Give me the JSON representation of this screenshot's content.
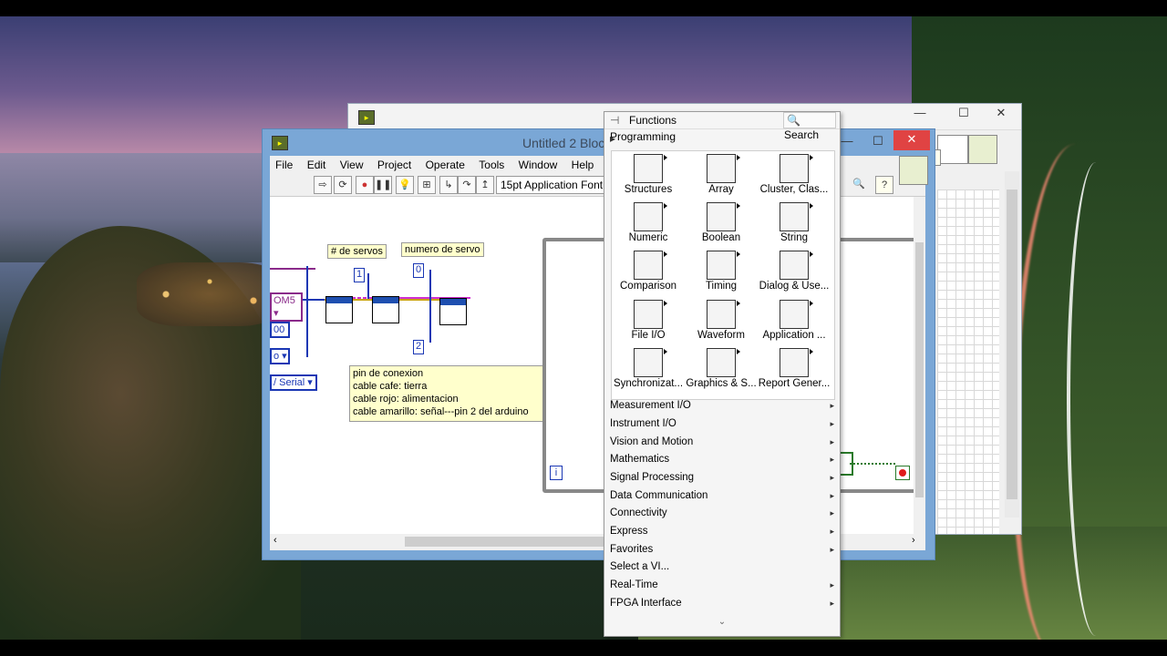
{
  "back_window": {
    "minimize": "—",
    "maximize": "☐",
    "close": "✕"
  },
  "main_window": {
    "title": "Untitled 2 Bloc",
    "minimize": "—",
    "maximize": "☐",
    "close": "✕",
    "menu": [
      "File",
      "Edit",
      "View",
      "Project",
      "Operate",
      "Tools",
      "Window",
      "Help"
    ],
    "font_selector": "15pt Application Font",
    "help_icon": "?"
  },
  "diagram": {
    "label_servos": "# de servos",
    "label_servo_num": "numero de servo",
    "const_1": "1",
    "const_0": "0",
    "const_2": "2",
    "com_port": "OM5",
    "baud": "00",
    "control_partial": "o",
    "serial_selector": "/ Serial",
    "comment": [
      "pin de conexion",
      "cable cafe: tierra",
      "cable rojo: alimentacion",
      "cable amarillo: señal---pin 2 del arduino"
    ],
    "iteration_terminal": "i"
  },
  "palette": {
    "title": "Functions",
    "search": "Search",
    "programming": "Programming",
    "icons": [
      {
        "label": "Structures",
        "icon": "structures-icon"
      },
      {
        "label": "Array",
        "icon": "array-icon"
      },
      {
        "label": "Cluster, Clas...",
        "icon": "cluster-icon"
      },
      {
        "label": "Numeric",
        "icon": "numeric-icon"
      },
      {
        "label": "Boolean",
        "icon": "boolean-icon"
      },
      {
        "label": "String",
        "icon": "string-icon"
      },
      {
        "label": "Comparison",
        "icon": "comparison-icon"
      },
      {
        "label": "Timing",
        "icon": "timing-icon"
      },
      {
        "label": "Dialog & Use...",
        "icon": "dialog-icon"
      },
      {
        "label": "File I/O",
        "icon": "file-io-icon"
      },
      {
        "label": "Waveform",
        "icon": "waveform-icon"
      },
      {
        "label": "Application ...",
        "icon": "application-icon"
      },
      {
        "label": "Synchronizat...",
        "icon": "synchronization-icon"
      },
      {
        "label": "Graphics & S...",
        "icon": "graphics-icon"
      },
      {
        "label": "Report Gener...",
        "icon": "report-icon"
      }
    ],
    "categories": [
      {
        "label": "Measurement I/O",
        "has_sub": true
      },
      {
        "label": "Instrument I/O",
        "has_sub": true
      },
      {
        "label": "Vision and Motion",
        "has_sub": true
      },
      {
        "label": "Mathematics",
        "has_sub": true
      },
      {
        "label": "Signal Processing",
        "has_sub": true
      },
      {
        "label": "Data Communication",
        "has_sub": true
      },
      {
        "label": "Connectivity",
        "has_sub": true
      },
      {
        "label": "Express",
        "has_sub": true
      },
      {
        "label": "Favorites",
        "has_sub": true
      },
      {
        "label": "Select a VI...",
        "has_sub": false
      },
      {
        "label": "Real-Time",
        "has_sub": true
      },
      {
        "label": "FPGA Interface",
        "has_sub": true
      }
    ],
    "more_chevron": "⌄"
  }
}
